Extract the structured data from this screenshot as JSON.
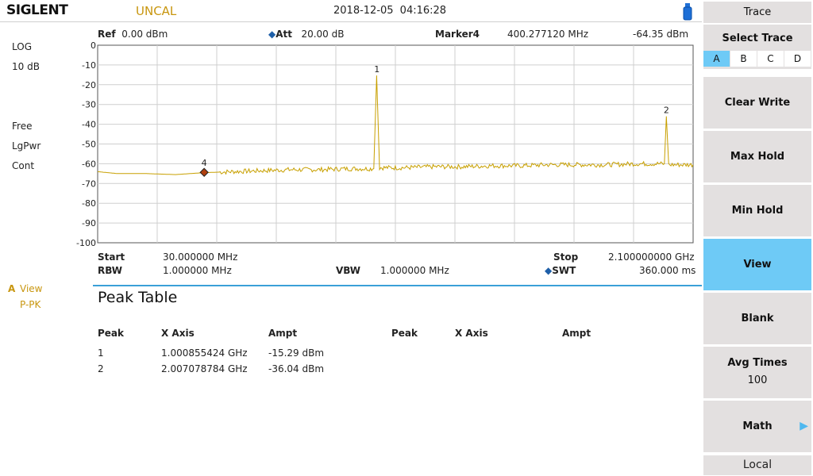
{
  "header": {
    "brand": "SIGLENT",
    "status": "UNCAL",
    "datetime": "2018-12-05   04:16:28"
  },
  "left_panel": {
    "scale_type": "LOG",
    "scale_div": "10 dB",
    "trigger": "Free",
    "detector": "LgPwr",
    "sweep_mode": "Cont",
    "trace_letter": "A",
    "trace_state": "View",
    "trace_detector": "P-PK"
  },
  "top_info": {
    "ref_label": "Ref",
    "ref_value": "0.00 dBm",
    "att_label": "Att",
    "att_value": "20.00 dB",
    "marker_label": "Marker4",
    "marker_freq": "400.277120 MHz",
    "marker_ampl": "-64.35 dBm"
  },
  "bottom_info": {
    "start_label": "Start",
    "start_value": "30.000000 MHz",
    "stop_label": "Stop",
    "stop_value": "2.100000000 GHz",
    "rbw_label": "RBW",
    "rbw_value": "1.000000 MHz",
    "vbw_label": "VBW",
    "vbw_value": "1.000000 MHz",
    "swt_label": "SWT",
    "swt_value": "360.000 ms"
  },
  "peak_table": {
    "title": "Peak Table",
    "headers": [
      "Peak",
      "X Axis",
      "Ampt",
      "Peak",
      "X Axis",
      "Ampt"
    ],
    "rows": [
      {
        "peak": "1",
        "x": "1.000855424 GHz",
        "ampt": "-15.29 dBm"
      },
      {
        "peak": "2",
        "x": "2.007078784 GHz",
        "ampt": "-36.04 dBm"
      }
    ]
  },
  "softkeys": {
    "title": "Trace",
    "select_trace": "Select Trace",
    "trace_options": [
      "A",
      "B",
      "C",
      "D"
    ],
    "selected_trace": "A",
    "clear_write": "Clear Write",
    "max_hold": "Max Hold",
    "min_hold": "Min Hold",
    "view": "View",
    "blank": "Blank",
    "avg_times": "Avg Times",
    "avg_times_value": "100",
    "math": "Math",
    "local": "Local"
  },
  "colors": {
    "trace": "#c8a000",
    "accent": "#6ecaf6",
    "marker": "#b0400f"
  },
  "chart_data": {
    "type": "line",
    "x_unit": "MHz",
    "y_unit": "dBm",
    "xlim": [
      30,
      2100
    ],
    "ylim": [
      -100,
      0
    ],
    "y_ticks": [
      "0",
      "-10",
      "-20",
      "-30",
      "-40",
      "-50",
      "-60",
      "-70",
      "-80",
      "-90",
      "-100"
    ],
    "grid": true,
    "series": [
      {
        "x": [
          30,
          100,
          200,
          300,
          400,
          500,
          600,
          700,
          800,
          900,
          990,
          1000,
          1010,
          1100,
          1200,
          1300,
          1400,
          1500,
          1600,
          1700,
          1800,
          1900,
          2000,
          2007,
          2015,
          2100
        ],
        "y": [
          -64,
          -65,
          -65,
          -65.5,
          -64.5,
          -64,
          -63.5,
          -63,
          -63,
          -62.5,
          -62.5,
          -15.29,
          -62,
          -62,
          -61.5,
          -61.5,
          -61,
          -61,
          -60.5,
          -60.5,
          -60.5,
          -60,
          -60,
          -36.04,
          -60.5,
          -60.5
        ]
      }
    ],
    "peaks": [
      {
        "label": "1",
        "x": 1000.855424,
        "y": -15.29
      },
      {
        "label": "2",
        "x": 2007.078784,
        "y": -36.04
      }
    ],
    "marker": {
      "label": "4",
      "x": 400.27712,
      "y": -64.35
    }
  }
}
